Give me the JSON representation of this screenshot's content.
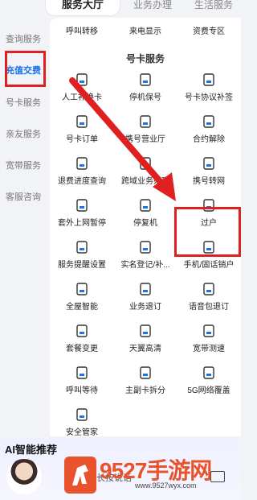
{
  "tabs": [
    "服务大厅",
    "业务办理",
    "生活服务"
  ],
  "sidebar": [
    "查询服务",
    "充值交费",
    "号卡服务",
    "亲友服务",
    "宽带服务",
    "客服咨询"
  ],
  "top_row": [
    "呼叫转移",
    "来电显示",
    "资费专区"
  ],
  "section_title": "号卡服务",
  "grid": [
    [
      "人工补换卡",
      "停机保号",
      "号卡协议补签"
    ],
    [
      "号卡订单",
      "携号营业厅",
      "合约解除"
    ],
    [
      "退费进度查询",
      "跨域业务办理",
      "携号转网"
    ],
    [
      "套外上网暂停",
      "停复机",
      "过户"
    ],
    [
      "服务提醒设置",
      "实名登记/补...",
      "手机/固话销户"
    ],
    [
      "全屋智能",
      "业务退订",
      "语音包退订"
    ],
    [
      "套餐变更",
      "天翼高清",
      "宽带测速"
    ],
    [
      "呼叫等待",
      "主副卡拆分",
      "5G网络覆盖"
    ],
    [
      "安全管家",
      "",
      ""
    ]
  ],
  "ai": {
    "title": "AI智能推荐",
    "hint": "长按说话"
  },
  "watermark": {
    "text": "9527手游网",
    "url": "www.9527wyx.com"
  },
  "colors": {
    "accent": "#1a73e8",
    "highlight_box": "#e02020",
    "watermark": "#e8532b"
  }
}
